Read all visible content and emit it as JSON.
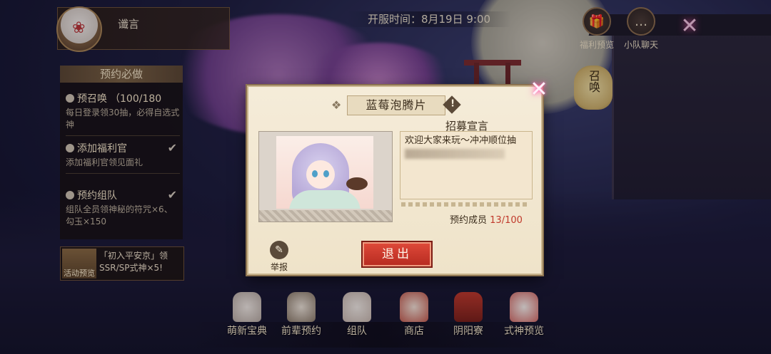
{
  "player": {
    "name": "谶言",
    "avatar_icon": "fox-mask-avatar"
  },
  "server_time": "开服时间：8月19日 9:00",
  "top_buttons": [
    {
      "label": "福利预览",
      "icon": "gift-icon"
    },
    {
      "label": "小队聊天",
      "icon": "chat-icon"
    }
  ],
  "close_icon": "close-icon",
  "summon_label": "召唤",
  "left_panel": {
    "title": "预约必做",
    "tasks": [
      {
        "title": "预召唤",
        "progress": "（100/180",
        "desc": "每日登录领30抽，必得自选式神",
        "done": false
      },
      {
        "title": "添加福利官",
        "progress": "",
        "desc": "添加福利官领见面礼",
        "done": true
      },
      {
        "title": "预约组队",
        "progress": "",
        "desc": "组队全员领神秘的符咒×6、勾玉×150",
        "done": true
      }
    ],
    "event": {
      "icon_label": "活动预览",
      "text": "「初入平安京」领SSR/SP式神×5!"
    }
  },
  "bottom_nav": [
    {
      "label": "萌新宝典",
      "icon": "cat-doll-icon"
    },
    {
      "label": "前辈预约",
      "icon": "figure-icon"
    },
    {
      "label": "组队",
      "icon": "team-doll-icon"
    },
    {
      "label": "商店",
      "icon": "lucky-cat-icon"
    },
    {
      "label": "阴阳寮",
      "icon": "shrine-icon"
    },
    {
      "label": "式神预览",
      "icon": "fox-mask-icon"
    }
  ],
  "modal": {
    "title": "蓝莓泡腾片",
    "info_icon": "!",
    "declaration_label": "招募宣言",
    "declaration_text": "欢迎大家来玩～冲冲顺位抽",
    "members_label": "预约成员",
    "members_count": "13/100",
    "report_label": "举报",
    "exit_label": "退出"
  },
  "colors": {
    "accent_red": "#c0392b",
    "panel_bg": "#f5ecd9",
    "close_glow": "#ff4fa8"
  }
}
